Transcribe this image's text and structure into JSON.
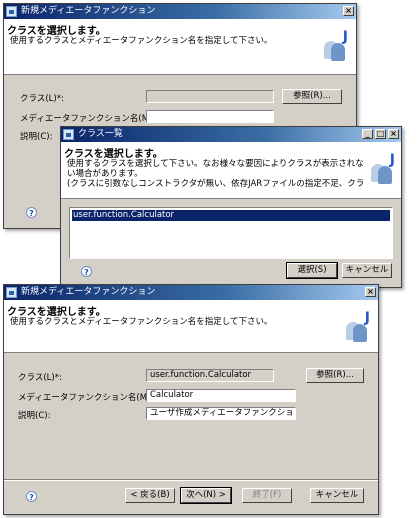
{
  "top_dialog": {
    "title": "新規メディエータファンクション",
    "close": "×",
    "banner_heading": "クラスを選択します。",
    "banner_desc": "使用するクラスとメディエータファンクション名を指定して下さい。",
    "banner_icon_letter": "J",
    "class_label": "クラス(L)*:",
    "class_value": "",
    "browse_button": "参照(R)...",
    "name_label": "メディエータファンクション名(M)*:",
    "name_value": "",
    "desc_label": "説明(C):",
    "help": "?"
  },
  "class_list_dialog": {
    "title": "クラス一覧",
    "minimize": "_",
    "maximize": "□",
    "close": "×",
    "banner_heading": "クラスを選択します。",
    "banner_desc_line1": "使用するクラスを選択して下さい。なお様々な要因によりクラスが表示されな",
    "banner_desc_line2": "い場合があります。",
    "banner_desc_line3": "(クラスに引数なしコンストラクタが無い、依存JARファイルの指定不足、クラ",
    "banner_icon_letter": "J",
    "list_items": [
      "user.function.Calculator"
    ],
    "select_button": "選択(S)",
    "cancel_button": "キャンセル",
    "help": "?"
  },
  "bottom_dialog": {
    "title": "新規メディエータファンクション",
    "close": "×",
    "banner_heading": "クラスを選択します。",
    "banner_desc": "使用するクラスとメディエータファンクション名を指定して下さい。",
    "banner_icon_letter": "J",
    "class_label": "クラス(L)*:",
    "class_value": "user.function.Calculator",
    "browse_button": "参照(R)...",
    "name_label": "メディエータファンクション名(M)*:",
    "name_value": "Calculator",
    "desc_label": "説明(C):",
    "desc_value": "ユーザ作成メディエータファンクション",
    "back_button": "< 戻る(B)",
    "next_button": "次へ(N) >",
    "finish_button": "終了(F)",
    "cancel_button": "キャンセル",
    "help": "?"
  }
}
